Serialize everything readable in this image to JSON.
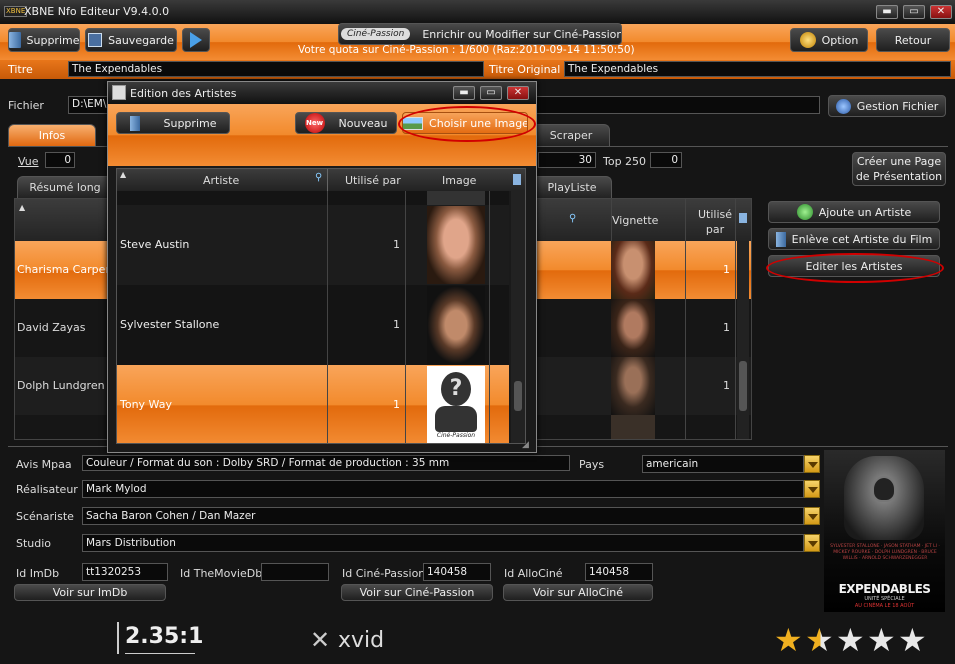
{
  "app": {
    "title": "XBNE Nfo Editeur V9.4.0.0",
    "logo": "XBNE"
  },
  "toolbar": {
    "supprime": "Supprime",
    "sauvegarde": "Sauvegarde",
    "cine_passion_badge": "Ciné-Passion",
    "enrichir": "Enrichir ou Modifier sur Ciné-Passion",
    "quota": "Votre quota sur Ciné-Passion : 1/600 (Raz:2010-09-14 11:50:50)",
    "option": "Option",
    "retour": "Retour"
  },
  "titles": {
    "titre_label": "Titre",
    "titre_value": "The Expendables",
    "titre_original_label": "Titre Original",
    "titre_original_value": "The Expendables"
  },
  "fichier": {
    "label": "Fichier",
    "value": "D:\\EM\\",
    "gestion": "Gestion Fichier"
  },
  "tabs": [
    "Infos",
    "Scraper"
  ],
  "stats": {
    "vue_label": "Vue",
    "vue_value": "0",
    "num_value": "30",
    "top_label": "Top 250",
    "top_value": "0"
  },
  "presentation_button": "Créer une Page de Présentation",
  "subtabs": [
    "Résumé long",
    "PlayListe"
  ],
  "actors_table": {
    "col_vignette": "Vignette",
    "col_utilise": "Utilisé par",
    "rows": [
      {
        "name": "Charisma Carpent",
        "count": "1",
        "avatar": "woman-photo"
      },
      {
        "name": "David Zayas",
        "count": "1",
        "avatar": "man-photo"
      },
      {
        "name": "Dolph Lundgren",
        "count": "1",
        "avatar": "man-photo"
      },
      {
        "name": "",
        "count": "",
        "avatar": "man-photo"
      }
    ]
  },
  "actor_actions": {
    "ajoute": "Ajoute un Artiste",
    "enleve": "Enlève cet Artiste du Film",
    "editer": "Editer les Artistes"
  },
  "dialog": {
    "title": "Edition des Artistes",
    "supprime": "Supprime",
    "new_badge": "New",
    "nouveau": "Nouveau",
    "choisir": "Choisir une Image",
    "col_artiste": "Artiste",
    "col_utilise": "Utilisé par",
    "col_image": "Image",
    "rows": [
      {
        "name": "Steve Austin",
        "count": "1"
      },
      {
        "name": "Sylvester Stallone",
        "count": "1"
      },
      {
        "name": "Tony Way",
        "count": "1",
        "placeholder_brand": "Ciné-Passion"
      }
    ]
  },
  "details": {
    "avis_label": "Avis Mpaa",
    "avis_value": "Couleur  / Format du son : Dolby SRD / Format de production : 35 mm",
    "pays_label": "Pays",
    "pays_value": "americain",
    "realisateur_label": "Réalisateur",
    "realisateur_value": "Mark Mylod",
    "scenariste_label": "Scénariste",
    "scenariste_value": "Sacha Baron Cohen / Dan Mazer",
    "studio_label": "Studio",
    "studio_value": "Mars Distribution"
  },
  "ids": {
    "imdb_label": "Id ImDb",
    "imdb_value": "tt1320253",
    "tmdb_label": "Id TheMovieDb",
    "tmdb_value": "",
    "cine_label": "Id Ciné-Passion",
    "cine_value": "140458",
    "allo_label": "Id AlloCiné",
    "allo_value": "140458",
    "voir_imdb": "Voir sur ImDb",
    "voir_cine": "Voir sur Ciné-Passion",
    "voir_allo": "Voir sur AlloCiné"
  },
  "media": {
    "ratio": "2.35:1",
    "codec": "xvid"
  },
  "poster": {
    "title": "EXPENDABLES",
    "subtitle": "UNITÉ SPÉCIALE",
    "date": "AU CINÉMA LE 18 AOÛT",
    "credits": "SYLVESTER STALLONE · JASON STATHAM · JET LI · MICKEY ROURKE · DOLPH LUNDGREN · BRUCE WILLIS · ARNOLD SCHWARZENEGGER"
  },
  "rating": {
    "value": 1.5,
    "max": 5
  },
  "colors": {
    "accent": "#f08a2c",
    "highlight": "#d10000"
  }
}
